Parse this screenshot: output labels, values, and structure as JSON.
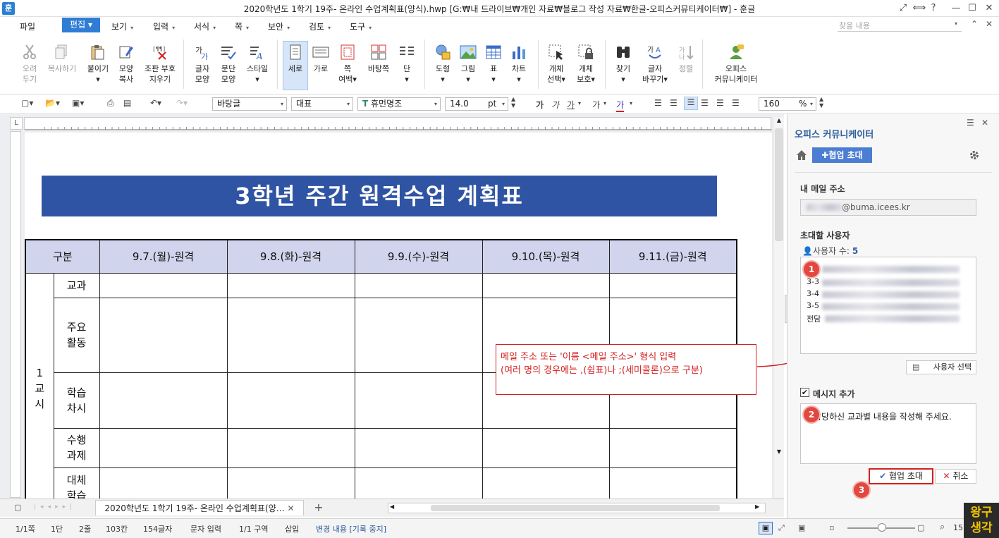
{
  "window": {
    "app_icon": "훈",
    "title": "2020학년도 1학기 19주- 온라인 수업계획표(양식).hwp [G:₩내 드라이브₩개인 자료₩블로그 작성 자료₩한글-오피스커뮤티케이터₩] - 훈글",
    "controls": [
      "⤢",
      "⟺",
      "?",
      "—",
      "☐",
      "✕"
    ]
  },
  "menu": {
    "items": [
      "파일",
      "편집",
      "보기",
      "입력",
      "서식",
      "쪽",
      "보안",
      "검토",
      "도구"
    ],
    "search_placeholder": "찾을 내용"
  },
  "ribbon": {
    "buttons": [
      {
        "l1": "오려",
        "l2": "두기"
      },
      {
        "l1": "복사하기",
        "l2": ""
      },
      {
        "l1": "붙이기",
        "l2": ""
      },
      {
        "l1": "모양",
        "l2": "복사"
      },
      {
        "l1": "조판 부호",
        "l2": "지우기"
      },
      {
        "l1": "글자",
        "l2": "모양"
      },
      {
        "l1": "문단",
        "l2": "모양"
      },
      {
        "l1": "스타일",
        "l2": ""
      },
      {
        "l1": "세로",
        "l2": ""
      },
      {
        "l1": "가로",
        "l2": ""
      },
      {
        "l1": "쪽",
        "l2": "여백"
      },
      {
        "l1": "바탕쪽",
        "l2": ""
      },
      {
        "l1": "단",
        "l2": ""
      },
      {
        "l1": "도형",
        "l2": ""
      },
      {
        "l1": "그림",
        "l2": ""
      },
      {
        "l1": "표",
        "l2": ""
      },
      {
        "l1": "차트",
        "l2": ""
      },
      {
        "l1": "개체",
        "l2": "선택"
      },
      {
        "l1": "개체",
        "l2": "보호"
      },
      {
        "l1": "찾기",
        "l2": ""
      },
      {
        "l1": "글자",
        "l2": "바꾸기"
      },
      {
        "l1": "정렬",
        "l2": ""
      },
      {
        "l1": "오피스",
        "l2": "커뮤니케이터"
      }
    ]
  },
  "toolbar": {
    "style": "바탕글",
    "lang": "대표",
    "font": "휴먼명조",
    "size": "14.0",
    "size_unit": "pt",
    "zoom": "160",
    "zoom_unit": "%",
    "font_styles": [
      "가",
      "가",
      "가",
      "가",
      "가"
    ]
  },
  "document": {
    "banner": "3학년 주간 원격수업 계획표",
    "header": [
      "구분",
      "9.7.(월)-원격",
      "9.8.(화)-원격",
      "9.9.(수)-원격",
      "9.10.(목)-원격",
      "9.11.(금)-원격"
    ],
    "period": "1 교 시",
    "rows": [
      "교과",
      "주요 활동",
      "학습 차시",
      "수행 과제",
      "대체 학습"
    ]
  },
  "callout": {
    "line1": "메일 주소 또는 '이름 <메일 주소>' 형식 입력",
    "line2": "(여러 명의 경우에는 ,(쉼표)나 ;(세미콜론)으로 구분)"
  },
  "tabs": {
    "doc_tab": "2020학년도 1학기 19주- 온라인 수업계획표(양…",
    "add": "+"
  },
  "status": {
    "items": [
      "1/1쪽",
      "1단",
      "2줄",
      "103칸",
      "154글자",
      "문자 입력",
      "1/1 구역",
      "삽입",
      "변경 내용 [기록 중지]"
    ],
    "zoom": "15"
  },
  "panel": {
    "title": "오피스 커뮤니케이터",
    "invite_button": "협업 초대",
    "my_email_label": "내 메일 주소",
    "my_email": "@buma.icees.kr",
    "invite_users_label": "초대할 사용자",
    "user_count_label": "사용자 수:",
    "user_count": "5",
    "user_prefixes": [
      "",
      "3-3",
      "3-4",
      "3-5",
      "전담"
    ],
    "user_select_button": "사용자 선택",
    "add_message_label": "메시지 추가",
    "message": "담당하신 교과별 내용을 작성해 주세요.",
    "ok_button": "협업 초대",
    "cancel_button": "취소",
    "badges": [
      "1",
      "2",
      "3"
    ]
  },
  "watermark": {
    "line1": "왕구",
    "line2": "생각"
  }
}
